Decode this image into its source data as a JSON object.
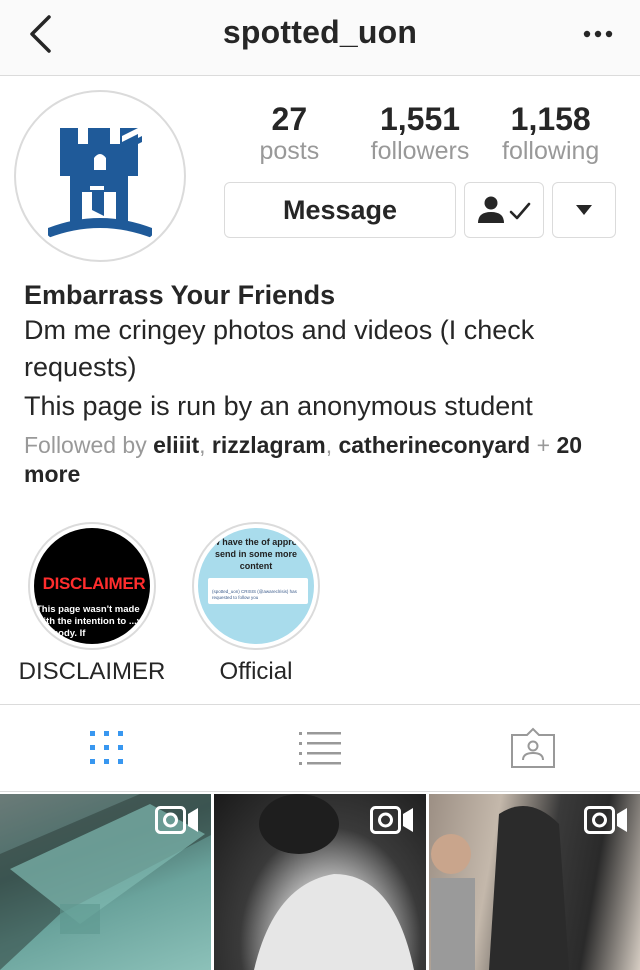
{
  "header": {
    "username": "spotted_uon",
    "back_icon": "chevron-left-icon",
    "more_icon": "ellipsis-icon"
  },
  "profile": {
    "stats": [
      {
        "count": "27",
        "label": "posts"
      },
      {
        "count": "1,551",
        "label": "followers"
      },
      {
        "count": "1,158",
        "label": "following"
      }
    ],
    "message_label": "Message",
    "following_icon": "person-check-icon",
    "dropdown_icon": "caret-down-icon"
  },
  "bio": {
    "name": "Embarrass Your Friends",
    "line1": "Dm me cringey photos and videos (I check requests)",
    "line2": "This page is run by an anonymous student",
    "followed_prefix": "Followed by ",
    "followers": [
      "eliiit",
      "rizzlagram",
      "catherineconyard"
    ],
    "followed_suffix": " + ",
    "more": "20 more"
  },
  "highlights": [
    {
      "label": "DISCLAIMER",
      "cover_title": "DISCLAIMER",
      "cover_text": "This page wasn't made with the intention to ...y anybody. If"
    },
    {
      "label": "Official",
      "cover_text": "...ow have the of approval, send in some more content",
      "card_text": "(spotted_uon) CRISIS (@awareclrisis) has requested to follow you"
    }
  ],
  "tabs": [
    {
      "icon": "grid-icon",
      "active": true
    },
    {
      "icon": "list-icon",
      "active": false
    },
    {
      "icon": "tagged-icon",
      "active": false
    }
  ],
  "posts": [
    {
      "type": "video"
    },
    {
      "type": "video"
    },
    {
      "type": "video"
    }
  ],
  "colors": {
    "accent": "#3897f0",
    "muted": "#999999",
    "text": "#262626",
    "border": "#dbdbdb",
    "logo_blue": "#1f5a99",
    "disclaimer_red": "#ff2d2d",
    "official_bg": "#a9dcec"
  }
}
